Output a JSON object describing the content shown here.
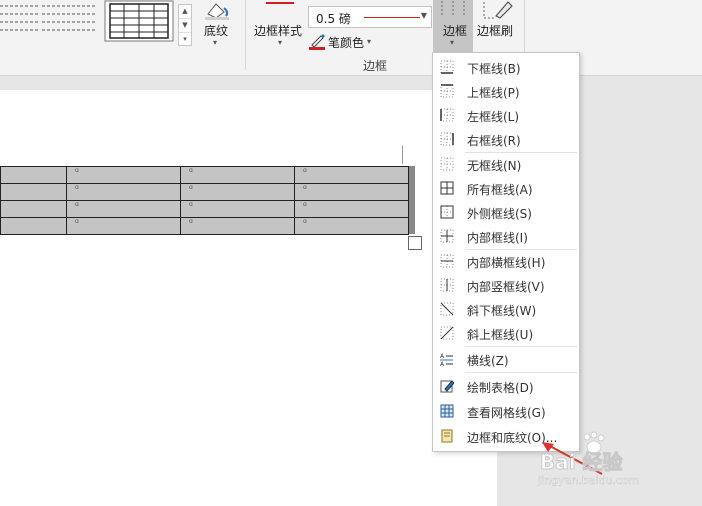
{
  "ribbon": {
    "shading_label": "底纹",
    "border_styles_label": "边框样式",
    "pen_weight_value": "0.5 磅",
    "pen_color_label": "笔颜色",
    "group_label": "边框",
    "borders_button_label": "边框",
    "border_painter_label": "边框刷",
    "accent_color": "#d02020"
  },
  "menu": {
    "items": [
      {
        "label": "下框线(B)",
        "icon": "bottom-border-icon"
      },
      {
        "label": "上框线(P)",
        "icon": "top-border-icon"
      },
      {
        "label": "左框线(L)",
        "icon": "left-border-icon"
      },
      {
        "label": "右框线(R)",
        "icon": "right-border-icon"
      },
      {
        "label": "无框线(N)",
        "icon": "no-border-icon"
      },
      {
        "label": "所有框线(A)",
        "icon": "all-borders-icon"
      },
      {
        "label": "外侧框线(S)",
        "icon": "outside-borders-icon"
      },
      {
        "label": "内部框线(I)",
        "icon": "inside-borders-icon"
      },
      {
        "label": "内部横框线(H)",
        "icon": "inside-horizontal-border-icon"
      },
      {
        "label": "内部竖框线(V)",
        "icon": "inside-vertical-border-icon"
      },
      {
        "label": "斜下框线(W)",
        "icon": "diagonal-down-border-icon"
      },
      {
        "label": "斜上框线(U)",
        "icon": "diagonal-up-border-icon"
      },
      {
        "label": "横线(Z)",
        "icon": "horizontal-line-icon"
      },
      {
        "label": "绘制表格(D)",
        "icon": "draw-table-icon"
      },
      {
        "label": "查看网格线(G)",
        "icon": "view-gridlines-icon"
      },
      {
        "label": "边框和底纹(O)...",
        "icon": "borders-and-shading-icon"
      }
    ]
  },
  "table": {
    "cell_marker": "ɑ"
  },
  "watermark": {
    "brand": "Bai 经验",
    "url": "jingyan.baidu.com"
  }
}
